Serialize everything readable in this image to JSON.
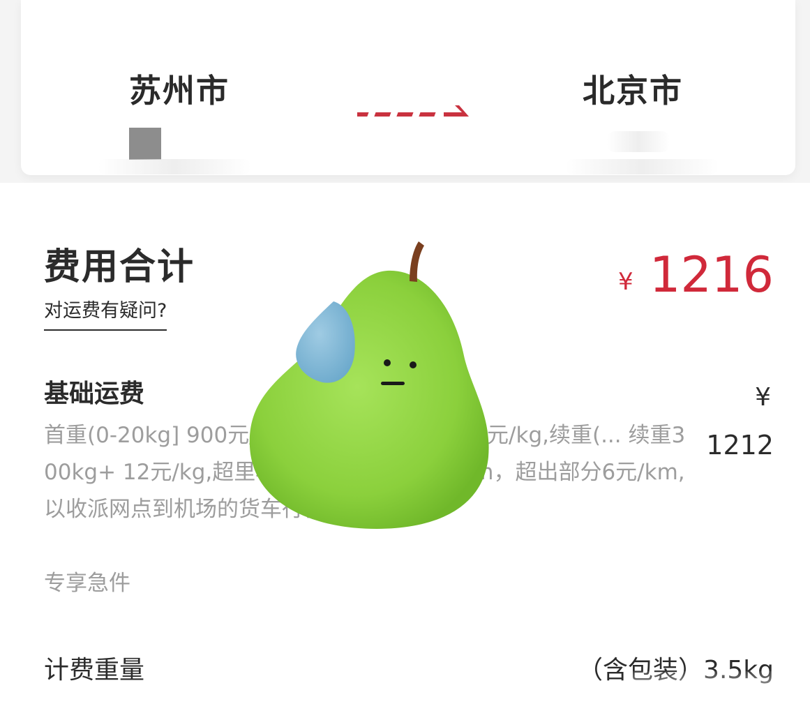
{
  "route": {
    "origin_city": "苏州市",
    "destination_city": "北京市"
  },
  "fee": {
    "title": "费用合计",
    "question_link": "对运费有疑问?",
    "currency_symbol": "¥",
    "total": "1216"
  },
  "base_fee": {
    "title": "基础运费",
    "description": "首重(0-20kg] 900元/kg,续重(50-100kg] 17元/kg,续重(... 续重300kg+ 12元/kg,超里程收费：312... 含30km，超出部分6元/km,以收派网点到机场的货车行驶距离计算);",
    "tag": "专享急件",
    "currency_symbol": "¥",
    "amount": "1212"
  },
  "weight": {
    "label": "计费重量",
    "value": "（含包装）3.5kg"
  },
  "colors": {
    "accent_red": "#d0293a",
    "text_dark": "#2b2b2b",
    "text_muted": "#9d9d9d",
    "pear_green": "#8fd23f",
    "drop_blue": "#79b6d6"
  },
  "icons": {
    "route_arrow": "dashed-arrow-right-icon",
    "sticker": "pear-sweat-sticker"
  }
}
